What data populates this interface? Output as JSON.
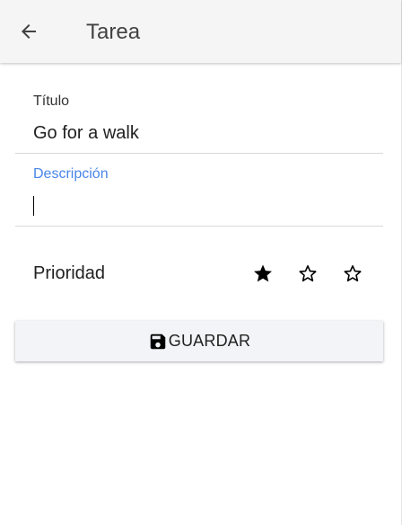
{
  "app_bar": {
    "title": "Tarea",
    "back_icon": "arrow-left-icon"
  },
  "form": {
    "title_field": {
      "label": "Título",
      "value": "Go for a walk"
    },
    "description_field": {
      "label": "Descripción",
      "value": "",
      "focused": true
    },
    "priority": {
      "label": "Prioridad",
      "value": 1,
      "max": 3,
      "filled_icon": "star-filled-icon",
      "empty_icon": "star-outline-icon"
    }
  },
  "save_button": {
    "label": "GUARDAR",
    "icon": "floppy-disk-icon"
  },
  "colors": {
    "app_bar_bg": "#f5f5f5",
    "focus_label": "#4a86e8",
    "button_bg": "#f3f4f7"
  }
}
